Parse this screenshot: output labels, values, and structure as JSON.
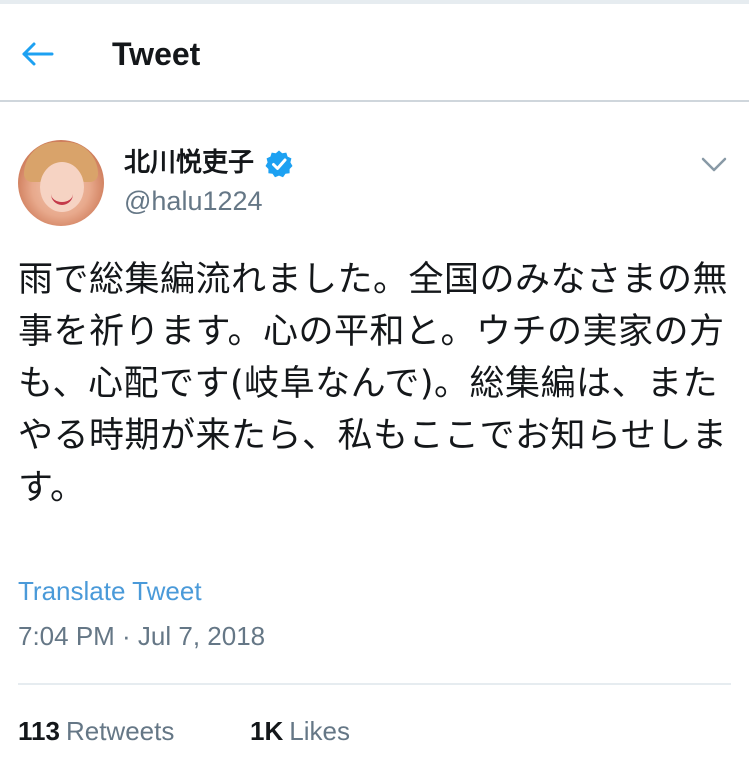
{
  "header": {
    "title": "Tweet",
    "back_icon": "arrow-left-icon",
    "accent_color": "#1da1f2"
  },
  "tweet": {
    "user": {
      "display_name": "北川悦吏子",
      "handle": "@halu1224",
      "verified": true,
      "verified_icon": "verified-badge-icon"
    },
    "menu_icon": "chevron-down-icon",
    "text": "雨で総集編流れました。全国のみなさまの無事を祈ります。心の平和と。ウチの実家の方も、心配です(岐阜なんで)。総集編は、またやる時期が来たら、私もここでお知らせします。",
    "translate_label": "Translate Tweet",
    "timestamp": "7:04 PM · Jul 7, 2018",
    "stats": {
      "retweets_count": "113",
      "retweets_label": "Retweets",
      "likes_count": "1K",
      "likes_label": "Likes"
    }
  }
}
